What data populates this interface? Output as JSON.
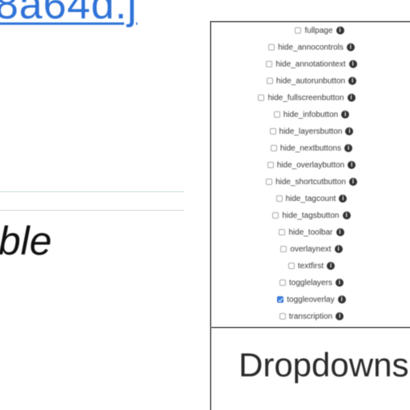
{
  "link_fragment": "8a64d.j",
  "italic_fragment": "ble",
  "options_panel": {
    "info_glyph": "i",
    "items": [
      {
        "label": "fullpage",
        "checked": false
      },
      {
        "label": "hide_annocontrols",
        "checked": false
      },
      {
        "label": "hide_annotationtext",
        "checked": false
      },
      {
        "label": "hide_autorunbutton",
        "checked": false
      },
      {
        "label": "hide_fullscreenbutton",
        "checked": false
      },
      {
        "label": "hide_infobutton",
        "checked": false
      },
      {
        "label": "hide_layersbutton",
        "checked": false
      },
      {
        "label": "hide_nextbuttons",
        "checked": false
      },
      {
        "label": "hide_overlaybutton",
        "checked": false
      },
      {
        "label": "hide_shortcutbutton",
        "checked": false
      },
      {
        "label": "hide_tagcount",
        "checked": false
      },
      {
        "label": "hide_tagsbutton",
        "checked": false
      },
      {
        "label": "hide_toolbar",
        "checked": false
      },
      {
        "label": "overlaynext",
        "checked": false
      },
      {
        "label": "textfirst",
        "checked": false
      },
      {
        "label": "togglelayers",
        "checked": false
      },
      {
        "label": "toggleoverlay",
        "checked": true
      },
      {
        "label": "transcription",
        "checked": false
      }
    ]
  },
  "dropdowns_section": {
    "title": "Dropdowns"
  }
}
